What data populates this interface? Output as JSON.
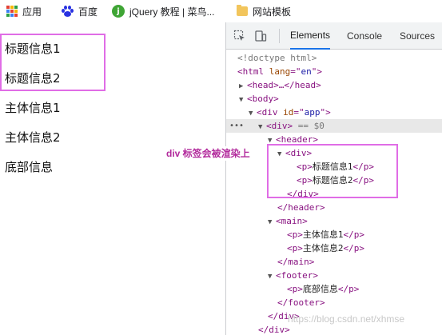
{
  "bookmarks": [
    {
      "label": "应用",
      "icon": "apps-grid-icon"
    },
    {
      "label": "百度",
      "icon": "baidu-paw-icon"
    },
    {
      "label": "jQuery 教程 | 菜鸟...",
      "icon": "jquery-icon"
    },
    {
      "label": "网站模板",
      "icon": "folder-icon"
    }
  ],
  "page": {
    "lines": [
      "标题信息1",
      "标题信息2",
      "主体信息1",
      "主体信息2",
      "底部信息"
    ]
  },
  "devtools": {
    "tabs": [
      "Elements",
      "Console",
      "Sources"
    ],
    "active_tab": "Elements",
    "annotation": "div 标签会被渲染上",
    "tree": {
      "doctype": "<!doctype html>",
      "html_tag": "<html ",
      "html_attr": "lang",
      "html_eq": "=\"",
      "html_val": "en",
      "html_end": "\">",
      "head": "<head>…</head>",
      "body_open": "<body>",
      "div_app_open": "<div ",
      "div_app_attr": "id",
      "div_app_val": "app",
      "div_app_end": ">",
      "div_sel": "<div>",
      "div_sel_suffix": " == $0",
      "header_open": "<header>",
      "div_open": "<div>",
      "p_open": "<p>",
      "p_close": "</p>",
      "p1_text": "标题信息1",
      "p2_text": "标题信息2",
      "div_close": "</div>",
      "header_close": "</header>",
      "main_open": "<main>",
      "m1_text": "主体信息1",
      "m2_text": "主体信息2",
      "main_close": "</main>",
      "footer_open": "<footer>",
      "f1_text": "底部信息",
      "footer_close": "</footer>",
      "div_close2": "</div>",
      "div_close3": "</div>"
    }
  },
  "watermark": "https://blog.csdn.net/xhmse",
  "colors": {
    "highlight": "#e06de6",
    "tag": "#881280",
    "active_tab_underline": "#1a73e8"
  }
}
